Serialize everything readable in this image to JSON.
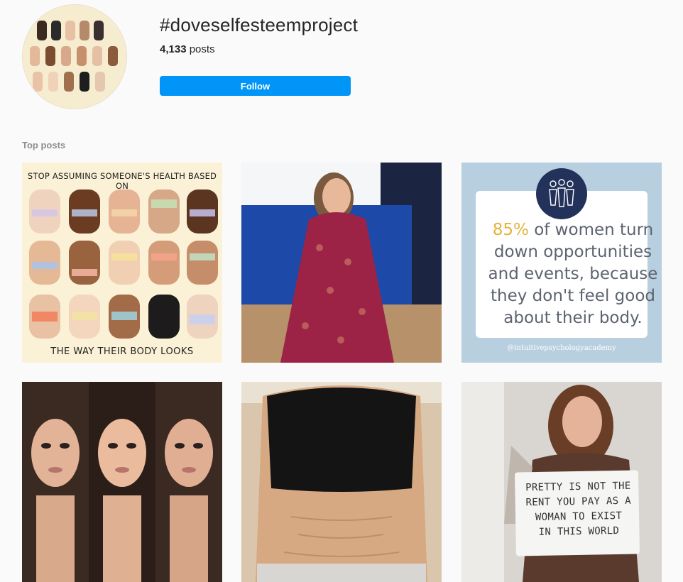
{
  "header": {
    "hashtag": "#doveselfesteemproject",
    "post_count": "4,133",
    "post_suffix": " posts",
    "follow_label": "Follow"
  },
  "section": {
    "top_posts_label": "Top posts"
  },
  "posts": [
    {
      "kind": "illustration",
      "title": "STOP ASSUMING SOMEONE'S HEALTH BASED ON",
      "footer": "THE WAY THEIR BODY LOOKS"
    },
    {
      "kind": "photo"
    },
    {
      "kind": "quote",
      "percent": "85%",
      "line1": " of women turn",
      "line2": "down opportunities",
      "line3": "and events, because",
      "line4": "they don't feel good",
      "line5": "about their body.",
      "handle": "@intuitivepsychologyacademy"
    },
    {
      "kind": "photo"
    },
    {
      "kind": "photo"
    },
    {
      "kind": "photo-sign",
      "sign_line1": "PRETTY IS NOT THE",
      "sign_line2": "RENT YOU PAY AS A",
      "sign_line3": "WOMAN TO EXIST",
      "sign_line4": "IN THIS WORLD"
    }
  ],
  "colors": {
    "accent": "#0095f6",
    "background": "#fafafa",
    "quote_highlight": "#e4b33a"
  }
}
